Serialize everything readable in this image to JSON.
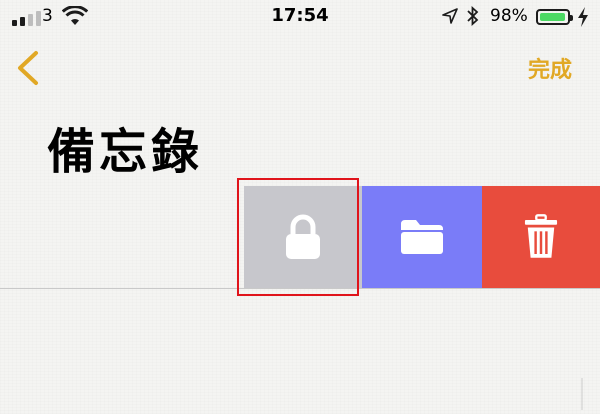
{
  "status_bar": {
    "carrier": "3",
    "time": "17:54",
    "battery_percent": "98%",
    "battery_level": 0.98,
    "icons": [
      "signal-icon",
      "wifi-icon",
      "location-arrow-icon",
      "bluetooth-icon",
      "battery-icon",
      "charging-bolt-icon"
    ]
  },
  "nav": {
    "back_icon": "chevron-left-icon",
    "done_label": "完成",
    "accent_color": "#e1a825"
  },
  "page": {
    "title": "備忘錄"
  },
  "swipe_actions": [
    {
      "id": "lock",
      "icon": "lock-icon",
      "color": "#c7c7cc",
      "highlighted": true
    },
    {
      "id": "move",
      "icon": "folder-icon",
      "color": "#7a7cf8"
    },
    {
      "id": "delete",
      "icon": "trash-icon",
      "color": "#e84c3d"
    }
  ],
  "colors": {
    "highlight": "#e0141b",
    "battery_fill": "#4cd964"
  }
}
